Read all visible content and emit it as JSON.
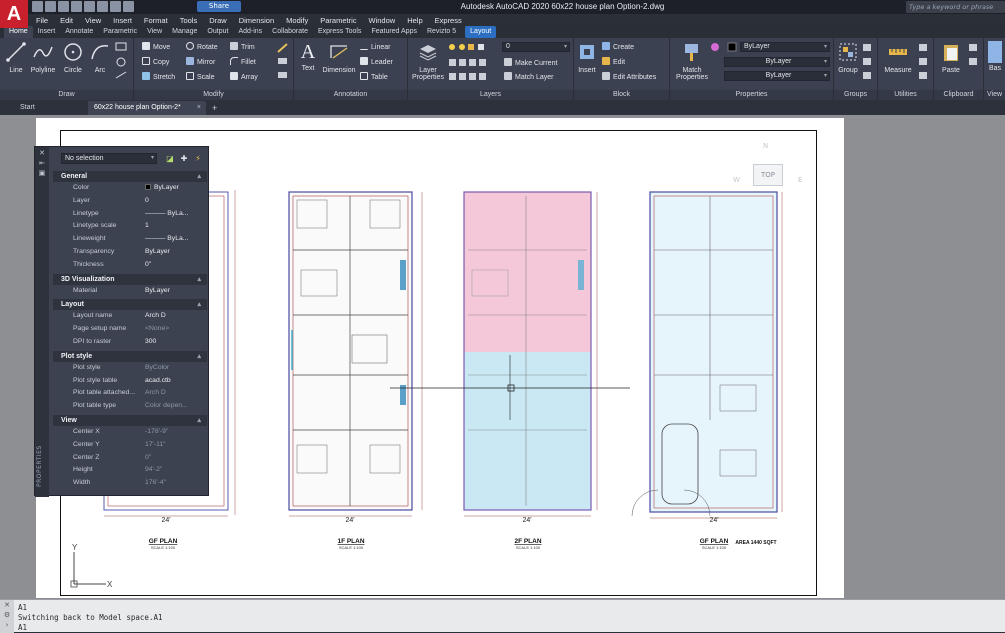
{
  "app": {
    "logo_letter": "A"
  },
  "window": {
    "title": "Autodesk AutoCAD 2020    60x22 house plan Option-2.dwg",
    "share_label": "Share",
    "search_placeholder": "Type a keyword or phrase"
  },
  "menu": [
    "File",
    "Edit",
    "View",
    "Insert",
    "Format",
    "Tools",
    "Draw",
    "Dimension",
    "Modify",
    "Parametric",
    "Window",
    "Help",
    "Express"
  ],
  "ribbon_tabs": [
    {
      "label": "Home",
      "active": true
    },
    {
      "label": "Insert"
    },
    {
      "label": "Annotate"
    },
    {
      "label": "Parametric"
    },
    {
      "label": "View"
    },
    {
      "label": "Manage"
    },
    {
      "label": "Output"
    },
    {
      "label": "Add-ins"
    },
    {
      "label": "Collaborate"
    },
    {
      "label": "Express Tools"
    },
    {
      "label": "Featured Apps"
    },
    {
      "label": "Revizto 5"
    },
    {
      "label": "Layout",
      "highlight": true
    }
  ],
  "ribbon": {
    "draw": {
      "label": "Draw",
      "line": "Line",
      "polyline": "Polyline",
      "circle": "Circle",
      "arc": "Arc"
    },
    "modify": {
      "label": "Modify",
      "move": "Move",
      "rotate": "Rotate",
      "trim": "Trim",
      "copy": "Copy",
      "mirror": "Mirror",
      "fillet": "Fillet",
      "stretch": "Stretch",
      "scale": "Scale",
      "array": "Array"
    },
    "annotation": {
      "label": "Annotation",
      "text": "Text",
      "dimension": "Dimension",
      "linear": "Linear",
      "leader": "Leader",
      "table": "Table"
    },
    "layers": {
      "label": "Layers",
      "layer_properties_1": "Layer",
      "layer_properties_2": "Properties",
      "current_layer": "0",
      "make_current": "Make Current",
      "match_layer": "Match Layer"
    },
    "block": {
      "label": "Block",
      "insert": "Insert",
      "create": "Create",
      "edit": "Edit",
      "edit_attributes": "Edit Attributes"
    },
    "properties": {
      "label": "Properties",
      "match_1": "Match",
      "match_2": "Properties",
      "color": "ByLayer",
      "linetype": "ByLayer",
      "lineweight": "ByLayer"
    },
    "groups": {
      "label": "Groups",
      "group": "Group"
    },
    "utilities": {
      "label": "Utilities",
      "measure": "Measure"
    },
    "clipboard": {
      "label": "Clipboard",
      "paste": "Paste"
    },
    "view": {
      "label": "View",
      "base": "Bas"
    }
  },
  "file_tabs": {
    "start": "Start",
    "drawing": "60x22 house plan Option-2*",
    "close": "×",
    "new": "+"
  },
  "viewcube": {
    "north": "N",
    "top": "TOP",
    "west": "W",
    "east": "E"
  },
  "ucs": {
    "x": "X",
    "y": "Y"
  },
  "plans": [
    {
      "label": "GF PLAN",
      "scale": "SCALE 1:100",
      "width_dim": "24'"
    },
    {
      "label": "1F PLAN",
      "scale": "SCALE 1:100",
      "width_dim": "24'"
    },
    {
      "label": "2F PLAN",
      "scale": "SCALE 1:100",
      "width_dim": "24'"
    },
    {
      "label": "GF PLAN",
      "scale": "SCALE 1:100",
      "width_dim": "24'",
      "area": "AREA 1440 SQFT"
    }
  ],
  "properties_palette": {
    "selection": "No selection",
    "side_title": "PROPERTIES",
    "sections": [
      {
        "title": "General",
        "rows": [
          {
            "k": "Color",
            "v": "ByLayer",
            "swatch": true
          },
          {
            "k": "Layer",
            "v": "0"
          },
          {
            "k": "Linetype",
            "v": "——— ByLa..."
          },
          {
            "k": "Linetype scale",
            "v": "1"
          },
          {
            "k": "Lineweight",
            "v": "——— ByLa..."
          },
          {
            "k": "Transparency",
            "v": "ByLayer"
          },
          {
            "k": "Thickness",
            "v": "0\""
          }
        ]
      },
      {
        "title": "3D Visualization",
        "rows": [
          {
            "k": "Material",
            "v": "ByLayer"
          }
        ]
      },
      {
        "title": "Layout",
        "rows": [
          {
            "k": "Layout name",
            "v": "Arch D"
          },
          {
            "k": "Page setup name",
            "v": "<None>",
            "dim": true
          },
          {
            "k": "DPI to raster",
            "v": "300"
          }
        ]
      },
      {
        "title": "Plot style",
        "rows": [
          {
            "k": "Plot style",
            "v": "ByColor",
            "dim": true
          },
          {
            "k": "Plot style table",
            "v": "acad.ctb"
          },
          {
            "k": "Plot table attached...",
            "v": "Arch D",
            "dim": true
          },
          {
            "k": "Plot table type",
            "v": "Color depen...",
            "dim": true
          }
        ]
      },
      {
        "title": "View",
        "rows": [
          {
            "k": "Center X",
            "v": "-178'-9\"",
            "dim": true
          },
          {
            "k": "Center Y",
            "v": "17'-11\"",
            "dim": true
          },
          {
            "k": "Center Z",
            "v": "0\"",
            "dim": true
          },
          {
            "k": "Height",
            "v": "94'-2\"",
            "dim": true
          },
          {
            "k": "Width",
            "v": "176'-4\"",
            "dim": true
          }
        ]
      }
    ]
  },
  "command_line": {
    "history_1": "A1",
    "history_2": "Switching back to Model space.A1",
    "current": "A1"
  }
}
